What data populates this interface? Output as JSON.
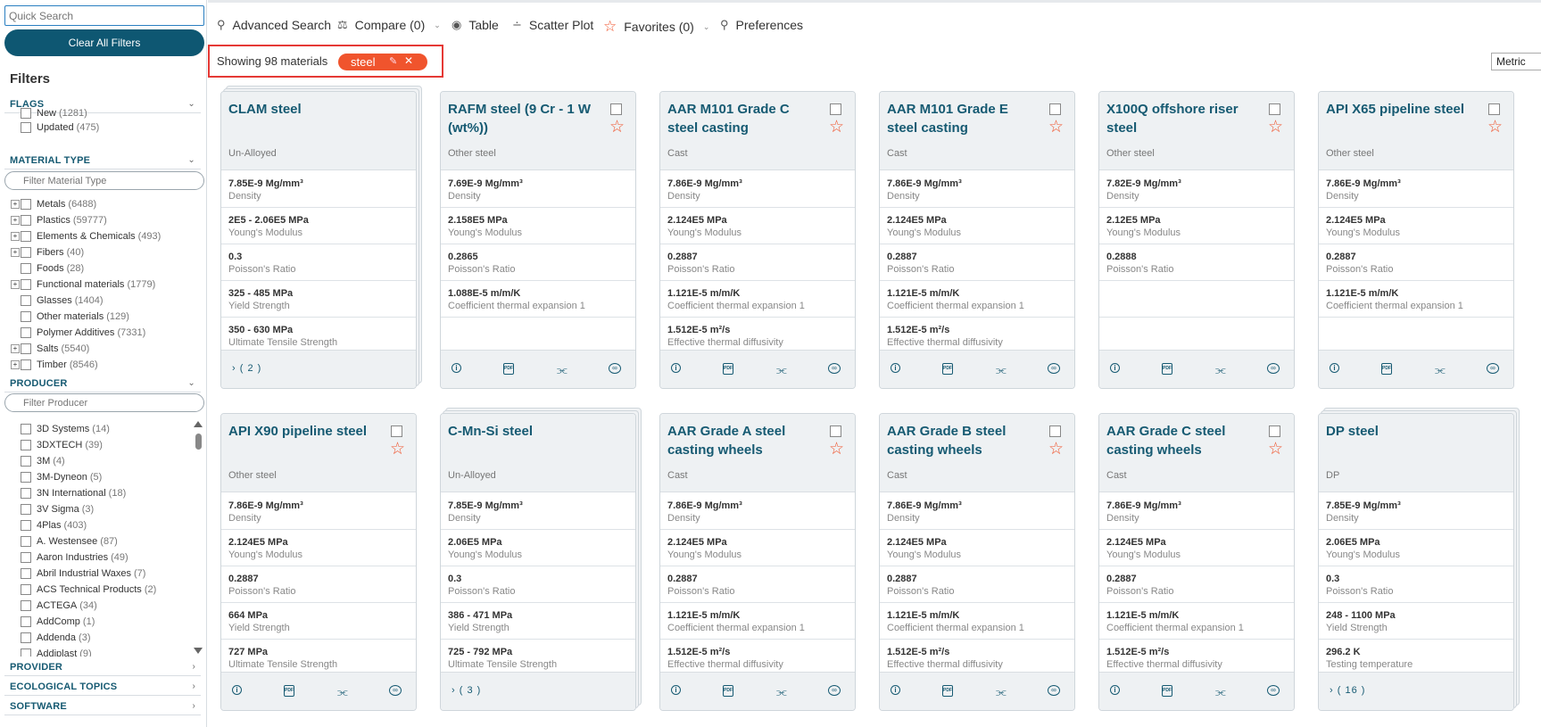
{
  "sidebar": {
    "quick_search_placeholder": "Quick Search",
    "clear_label": "Clear All Filters",
    "filters_title": "Filters",
    "flags_header": "FLAGS",
    "flags": [
      {
        "label": "New",
        "count": "(1281)"
      },
      {
        "label": "Updated",
        "count": "(475)"
      }
    ],
    "material_type_header": "MATERIAL TYPE",
    "material_type_placeholder": "Filter Material Type",
    "material_types": [
      {
        "label": "Metals",
        "count": "(6488)",
        "expand": "+"
      },
      {
        "label": "Plastics",
        "count": "(59777)",
        "expand": "+"
      },
      {
        "label": "Elements & Chemicals",
        "count": "(493)",
        "expand": "+"
      },
      {
        "label": "Fibers",
        "count": "(40)",
        "expand": "+"
      },
      {
        "label": "Foods",
        "count": "(28)",
        "expand": ""
      },
      {
        "label": "Functional materials",
        "count": "(1779)",
        "expand": "+"
      },
      {
        "label": "Glasses",
        "count": "(1404)",
        "expand": ""
      },
      {
        "label": "Other materials",
        "count": "(129)",
        "expand": ""
      },
      {
        "label": "Polymer Additives",
        "count": "(7331)",
        "expand": ""
      },
      {
        "label": "Salts",
        "count": "(5540)",
        "expand": "+"
      },
      {
        "label": "Timber",
        "count": "(8546)",
        "expand": "+"
      }
    ],
    "producer_header": "PRODUCER",
    "producer_placeholder": "Filter Producer",
    "producers": [
      {
        "label": "3D Systems",
        "count": "(14)"
      },
      {
        "label": "3DXTECH",
        "count": "(39)"
      },
      {
        "label": "3M",
        "count": "(4)"
      },
      {
        "label": "3M-Dyneon",
        "count": "(5)"
      },
      {
        "label": "3N International",
        "count": "(18)"
      },
      {
        "label": "3V Sigma",
        "count": "(3)"
      },
      {
        "label": "4Plas",
        "count": "(403)"
      },
      {
        "label": "A. Westensee",
        "count": "(87)"
      },
      {
        "label": "Aaron Industries",
        "count": "(49)"
      },
      {
        "label": "Abril Industrial Waxes",
        "count": "(7)"
      },
      {
        "label": "ACS Technical Products",
        "count": "(2)"
      },
      {
        "label": "ACTEGA",
        "count": "(34)"
      },
      {
        "label": "AddComp",
        "count": "(1)"
      },
      {
        "label": "Addenda",
        "count": "(3)"
      },
      {
        "label": "Addiplast",
        "count": "(9)"
      }
    ],
    "provider_header": "PROVIDER",
    "eco_header": "ECOLOGICAL TOPICS",
    "software_header": "SOFTWARE"
  },
  "toolbar": {
    "advanced_search": "Advanced Search",
    "compare": "Compare (0)",
    "table": "Table",
    "scatter": "Scatter Plot",
    "favorites": "Favorites (0)",
    "preferences": "Preferences"
  },
  "results": {
    "showing": "Showing 98 materials",
    "tag": "steel",
    "unit": "Metric"
  },
  "cards": [
    {
      "title": "CLAM steel",
      "subtitle": "Un-Alloyed",
      "stack": 2,
      "expand": "( 2 )",
      "selectable": false,
      "props": [
        [
          "7.85E-9 Mg/mm³",
          "Density"
        ],
        [
          "2E5 - 2.06E5 MPa",
          "Young's Modulus"
        ],
        [
          "0.3",
          "Poisson's Ratio"
        ],
        [
          "325 - 485 MPa",
          "Yield Strength"
        ],
        [
          "350 - 630 MPa",
          "Ultimate Tensile Strength"
        ]
      ]
    },
    {
      "title": "RAFM steel (9 Cr - 1 W (wt%))",
      "subtitle": "Other steel",
      "stack": 0,
      "expand": "",
      "selectable": true,
      "props": [
        [
          "7.69E-9 Mg/mm³",
          "Density"
        ],
        [
          "2.158E5 MPa",
          "Young's Modulus"
        ],
        [
          "0.2865",
          "Poisson's Ratio"
        ],
        [
          "1.088E-5 m/m/K",
          "Coefficient thermal expansion 1"
        ],
        [
          "",
          ""
        ]
      ]
    },
    {
      "title": "AAR M101 Grade C steel casting",
      "subtitle": "Cast",
      "stack": 0,
      "expand": "",
      "selectable": true,
      "props": [
        [
          "7.86E-9 Mg/mm³",
          "Density"
        ],
        [
          "2.124E5 MPa",
          "Young's Modulus"
        ],
        [
          "0.2887",
          "Poisson's Ratio"
        ],
        [
          "1.121E-5 m/m/K",
          "Coefficient thermal expansion 1"
        ],
        [
          "1.512E-5 m²/s",
          "Effective thermal diffusivity"
        ]
      ]
    },
    {
      "title": "AAR M101 Grade E steel casting",
      "subtitle": "Cast",
      "stack": 0,
      "expand": "",
      "selectable": true,
      "props": [
        [
          "7.86E-9 Mg/mm³",
          "Density"
        ],
        [
          "2.124E5 MPa",
          "Young's Modulus"
        ],
        [
          "0.2887",
          "Poisson's Ratio"
        ],
        [
          "1.121E-5 m/m/K",
          "Coefficient thermal expansion 1"
        ],
        [
          "1.512E-5 m²/s",
          "Effective thermal diffusivity"
        ]
      ]
    },
    {
      "title": "X100Q offshore riser steel",
      "subtitle": "Other steel",
      "stack": 0,
      "expand": "",
      "selectable": true,
      "props": [
        [
          "7.82E-9 Mg/mm³",
          "Density"
        ],
        [
          "2.12E5 MPa",
          "Young's Modulus"
        ],
        [
          "0.2888",
          "Poisson's Ratio"
        ],
        [
          "",
          ""
        ],
        [
          "",
          ""
        ]
      ]
    },
    {
      "title": "API X65 pipeline steel",
      "subtitle": "Other steel",
      "stack": 0,
      "expand": "",
      "selectable": true,
      "props": [
        [
          "7.86E-9 Mg/mm³",
          "Density"
        ],
        [
          "2.124E5 MPa",
          "Young's Modulus"
        ],
        [
          "0.2887",
          "Poisson's Ratio"
        ],
        [
          "1.121E-5 m/m/K",
          "Coefficient thermal expansion 1"
        ],
        [
          "",
          ""
        ]
      ]
    },
    {
      "title": "API X90 pipeline steel",
      "subtitle": "Other steel",
      "stack": 0,
      "expand": "",
      "selectable": true,
      "props": [
        [
          "7.86E-9 Mg/mm³",
          "Density"
        ],
        [
          "2.124E5 MPa",
          "Young's Modulus"
        ],
        [
          "0.2887",
          "Poisson's Ratio"
        ],
        [
          "664 MPa",
          "Yield Strength"
        ],
        [
          "727 MPa",
          "Ultimate Tensile Strength"
        ]
      ]
    },
    {
      "title": "C-Mn-Si steel",
      "subtitle": "Un-Alloyed",
      "stack": 2,
      "expand": "( 3 )",
      "selectable": false,
      "props": [
        [
          "7.85E-9 Mg/mm³",
          "Density"
        ],
        [
          "2.06E5 MPa",
          "Young's Modulus"
        ],
        [
          "0.3",
          "Poisson's Ratio"
        ],
        [
          "386 - 471 MPa",
          "Yield Strength"
        ],
        [
          "725 - 792 MPa",
          "Ultimate Tensile Strength"
        ]
      ]
    },
    {
      "title": "AAR Grade A steel casting wheels",
      "subtitle": "Cast",
      "stack": 0,
      "expand": "",
      "selectable": true,
      "props": [
        [
          "7.86E-9 Mg/mm³",
          "Density"
        ],
        [
          "2.124E5 MPa",
          "Young's Modulus"
        ],
        [
          "0.2887",
          "Poisson's Ratio"
        ],
        [
          "1.121E-5 m/m/K",
          "Coefficient thermal expansion 1"
        ],
        [
          "1.512E-5 m²/s",
          "Effective thermal diffusivity"
        ]
      ]
    },
    {
      "title": "AAR Grade B steel casting wheels",
      "subtitle": "Cast",
      "stack": 0,
      "expand": "",
      "selectable": true,
      "props": [
        [
          "7.86E-9 Mg/mm³",
          "Density"
        ],
        [
          "2.124E5 MPa",
          "Young's Modulus"
        ],
        [
          "0.2887",
          "Poisson's Ratio"
        ],
        [
          "1.121E-5 m/m/K",
          "Coefficient thermal expansion 1"
        ],
        [
          "1.512E-5 m²/s",
          "Effective thermal diffusivity"
        ]
      ]
    },
    {
      "title": "AAR Grade C steel casting wheels",
      "subtitle": "Cast",
      "stack": 0,
      "expand": "",
      "selectable": true,
      "props": [
        [
          "7.86E-9 Mg/mm³",
          "Density"
        ],
        [
          "2.124E5 MPa",
          "Young's Modulus"
        ],
        [
          "0.2887",
          "Poisson's Ratio"
        ],
        [
          "1.121E-5 m/m/K",
          "Coefficient thermal expansion 1"
        ],
        [
          "1.512E-5 m²/s",
          "Effective thermal diffusivity"
        ]
      ]
    },
    {
      "title": "DP steel",
      "subtitle": "DP",
      "stack": 2,
      "expand": "( 16 )",
      "selectable": false,
      "props": [
        [
          "7.85E-9 Mg/mm³",
          "Density"
        ],
        [
          "2.06E5 MPa",
          "Young's Modulus"
        ],
        [
          "0.3",
          "Poisson's Ratio"
        ],
        [
          "248 - 1100 MPa",
          "Yield Strength"
        ],
        [
          "296.2 K",
          "Testing temperature"
        ]
      ]
    }
  ],
  "colors": {
    "accent": "#f0542d",
    "brand": "#0e5772",
    "title": "#165a72",
    "highlight": "#e53935"
  }
}
